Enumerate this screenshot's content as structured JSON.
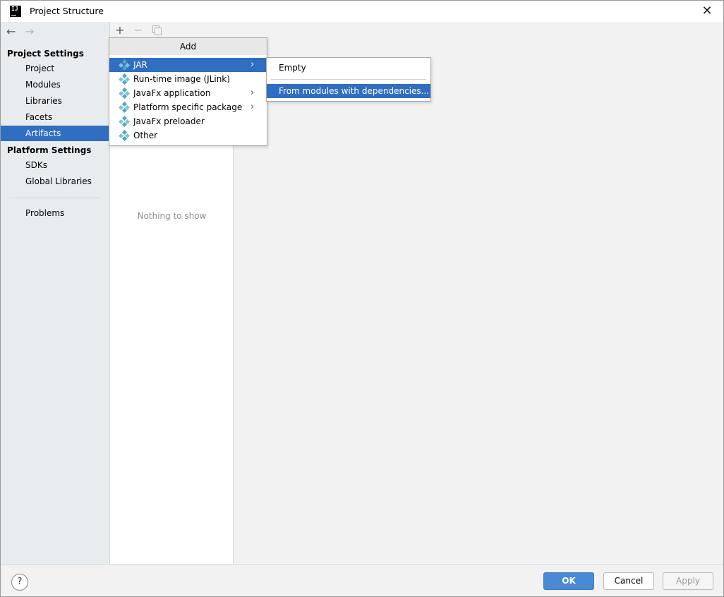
{
  "window": {
    "title": "Project Structure",
    "app_icon_text": "IJ",
    "close_glyph": "✕"
  },
  "nav": {
    "back_glyph": "←",
    "forward_glyph": "→"
  },
  "sidebar": {
    "project_settings_heading": "Project Settings",
    "project_items": [
      {
        "label": "Project"
      },
      {
        "label": "Modules"
      },
      {
        "label": "Libraries"
      },
      {
        "label": "Facets"
      },
      {
        "label": "Artifacts",
        "selected": true
      }
    ],
    "platform_settings_heading": "Platform Settings",
    "platform_items": [
      {
        "label": "SDKs"
      },
      {
        "label": "Global Libraries"
      }
    ],
    "problems_label": "Problems"
  },
  "toolbar": {
    "add_glyph": "+",
    "remove_glyph": "−"
  },
  "middle": {
    "empty_text": "Nothing to show"
  },
  "add_popup": {
    "title": "Add",
    "items": [
      {
        "label": "JAR",
        "submenu": true,
        "selected": true
      },
      {
        "label": "Run-time image (JLink)",
        "submenu": false
      },
      {
        "label": "JavaFx application",
        "submenu": true
      },
      {
        "label": "Platform specific package",
        "submenu": true
      },
      {
        "label": "JavaFx preloader",
        "submenu": false
      },
      {
        "label": "Other",
        "submenu": false
      }
    ],
    "chevron_glyph": "›"
  },
  "jar_submenu": {
    "items": [
      {
        "label": "Empty"
      },
      {
        "label": "From modules with dependencies...",
        "selected": true
      }
    ]
  },
  "footer": {
    "help_glyph": "?",
    "ok_label": "OK",
    "cancel_label": "Cancel",
    "apply_label": "Apply"
  },
  "colors": {
    "selection": "#2f6ec1",
    "sidebar_bg": "#e9ecef",
    "primary_button": "#4a8ad5",
    "icon_accent": "#4fa7c9"
  }
}
